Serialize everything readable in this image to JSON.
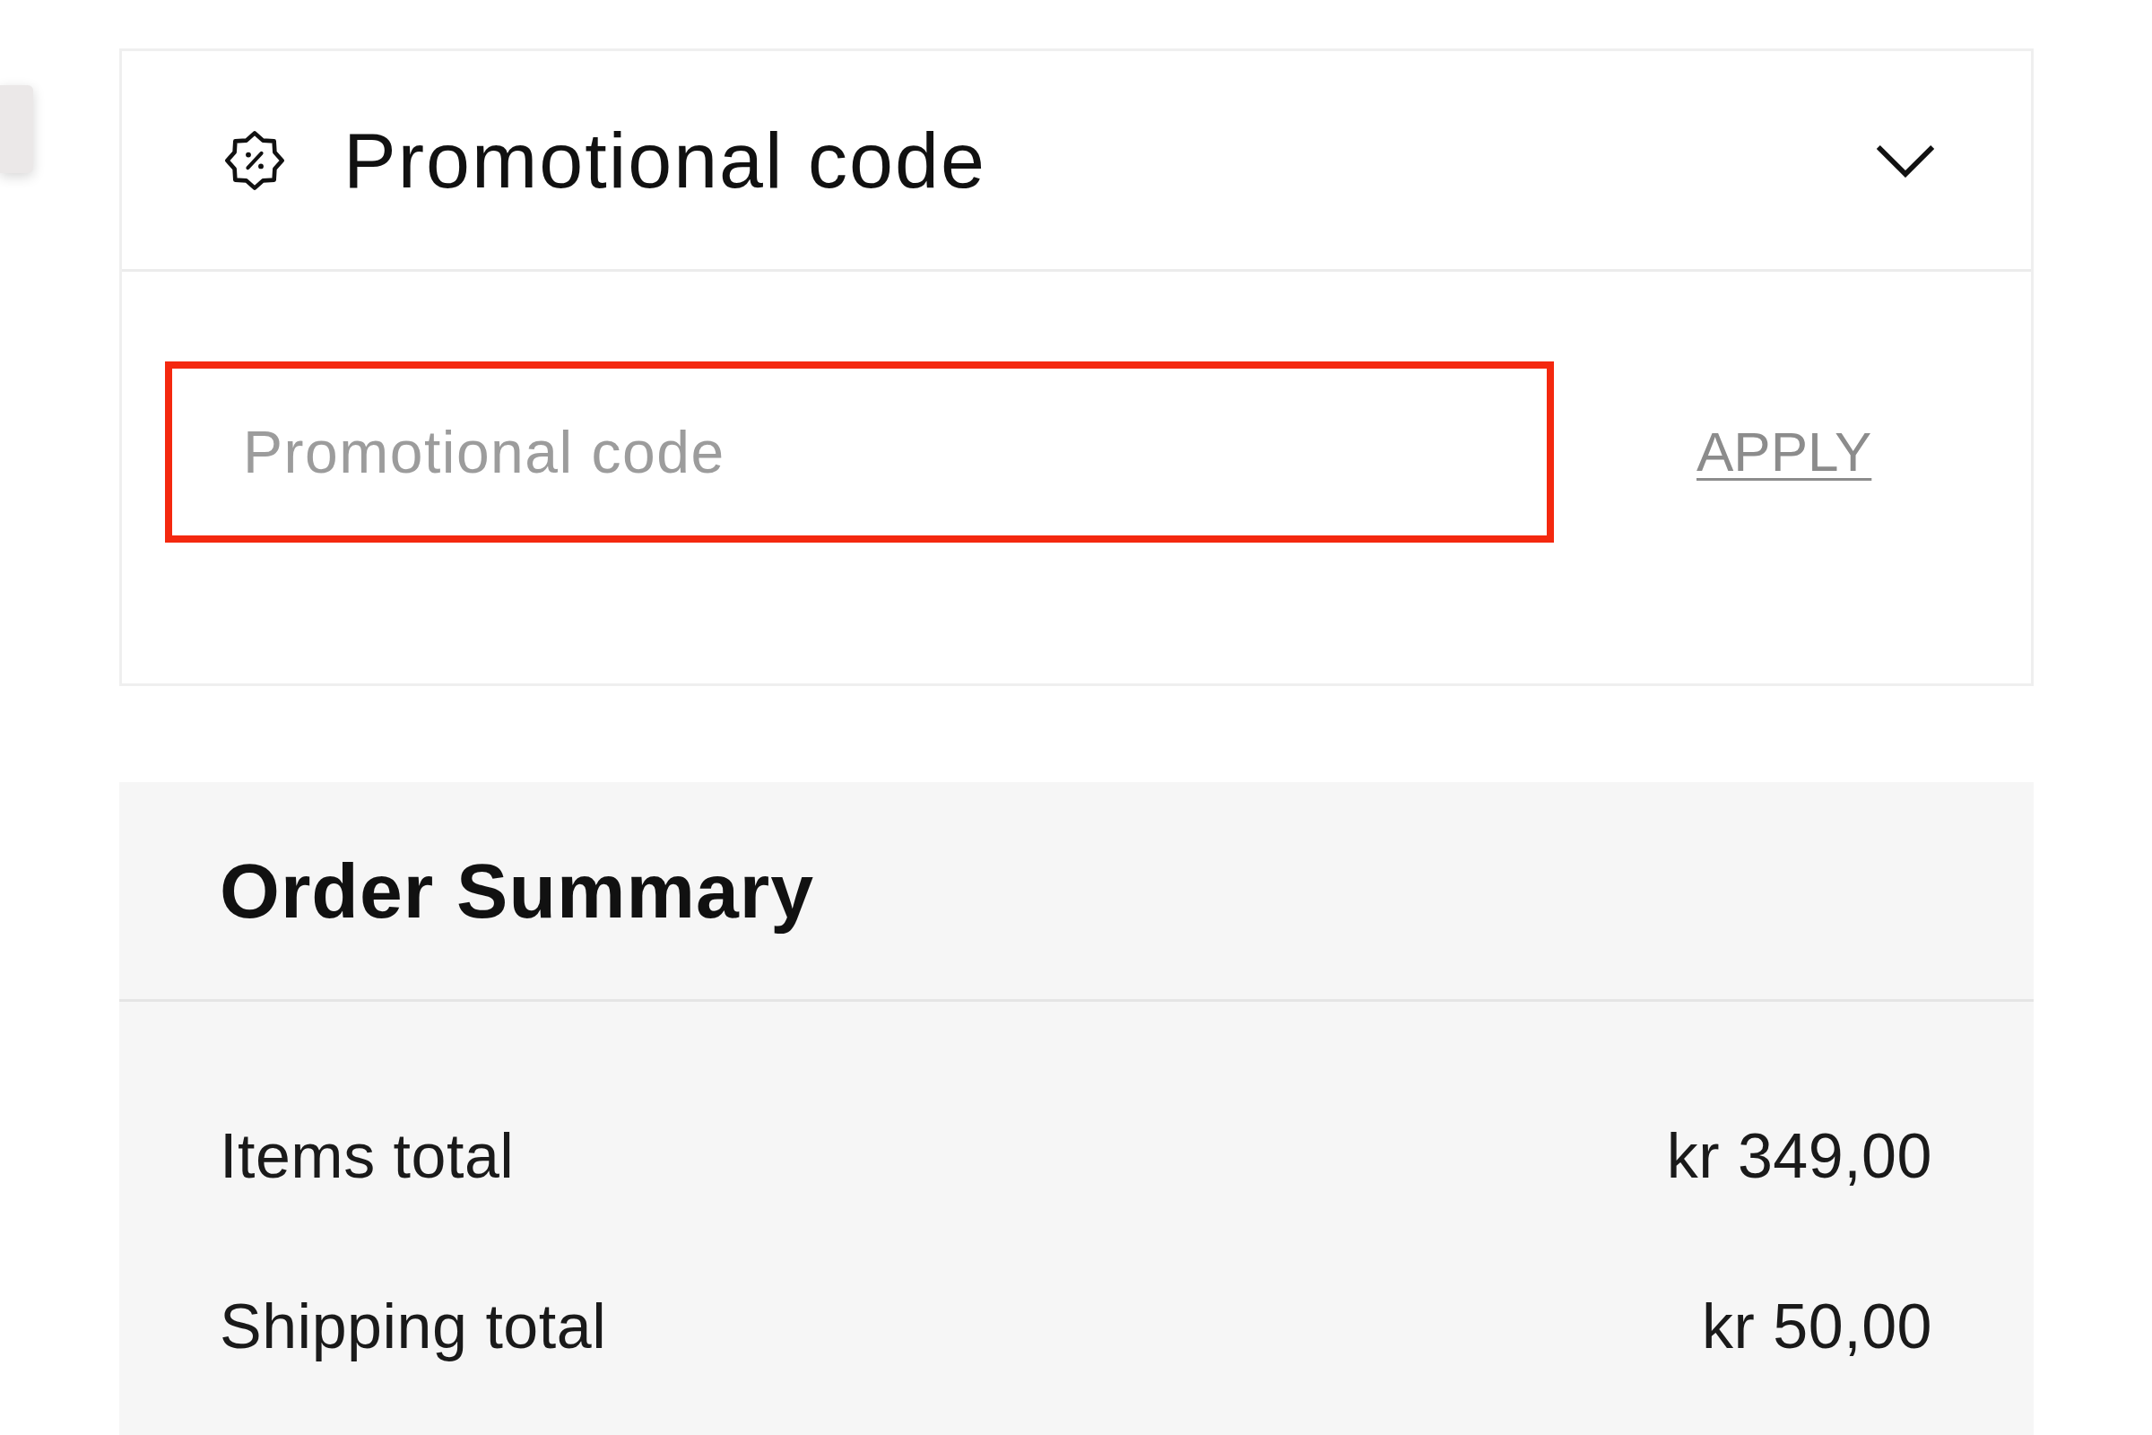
{
  "promo_section": {
    "title": "Promotional code",
    "expanded": true,
    "code_field": {
      "placeholder": "Promotional code",
      "error": true
    },
    "apply_link": "APPLY"
  },
  "order_summary": {
    "title": "Order Summary",
    "rows": [
      {
        "label": "Items total",
        "value": "kr 349,00"
      },
      {
        "label": "Shipping total",
        "value": "kr 50,00"
      }
    ]
  }
}
